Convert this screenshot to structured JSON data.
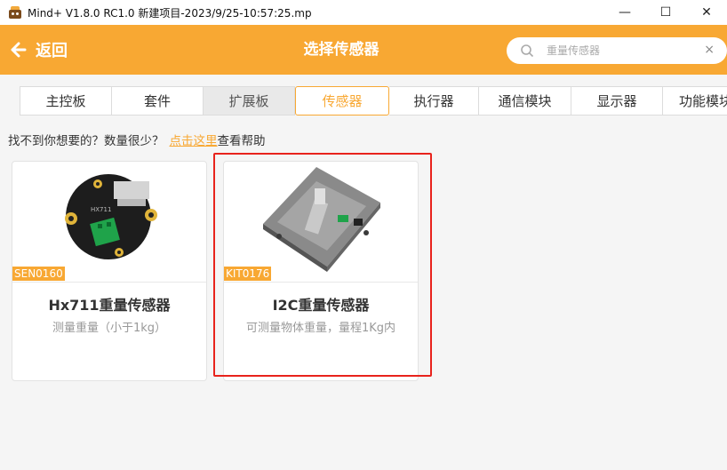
{
  "window": {
    "title": "Mind+ V1.8.0 RC1.0   新建项目-2023/9/25-10:57:25.mp",
    "minimize": "—",
    "maximize": "☐",
    "close": "✕"
  },
  "header": {
    "back_label": "返回",
    "title": "选择传感器",
    "search_placeholder": "重量传感器",
    "clear": "×"
  },
  "tabs": [
    {
      "label": "主控板",
      "state": "normal"
    },
    {
      "label": "套件",
      "state": "normal"
    },
    {
      "label": "扩展板",
      "state": "disabled"
    },
    {
      "label": "传感器",
      "state": "active"
    },
    {
      "label": "执行器",
      "state": "normal"
    },
    {
      "label": "通信模块",
      "state": "normal"
    },
    {
      "label": "显示器",
      "state": "normal"
    },
    {
      "label": "功能模块",
      "state": "normal"
    }
  ],
  "help": {
    "prefix": "找不到你想要的？数量很少？",
    "link": "点击这里",
    "suffix": "查看帮助"
  },
  "cards": [
    {
      "sku": "SEN0160",
      "name": "Hx711重量传感器",
      "desc": "测量重量（小于1kg）",
      "icon": "hx711-module-image"
    },
    {
      "sku": "KIT0176",
      "name": "I2C重量传感器",
      "desc": "可测量物体重量，量程1Kg内",
      "icon": "i2c-weight-kit-image"
    }
  ],
  "colors": {
    "accent": "#f8a833",
    "highlight": "#e8231c"
  }
}
